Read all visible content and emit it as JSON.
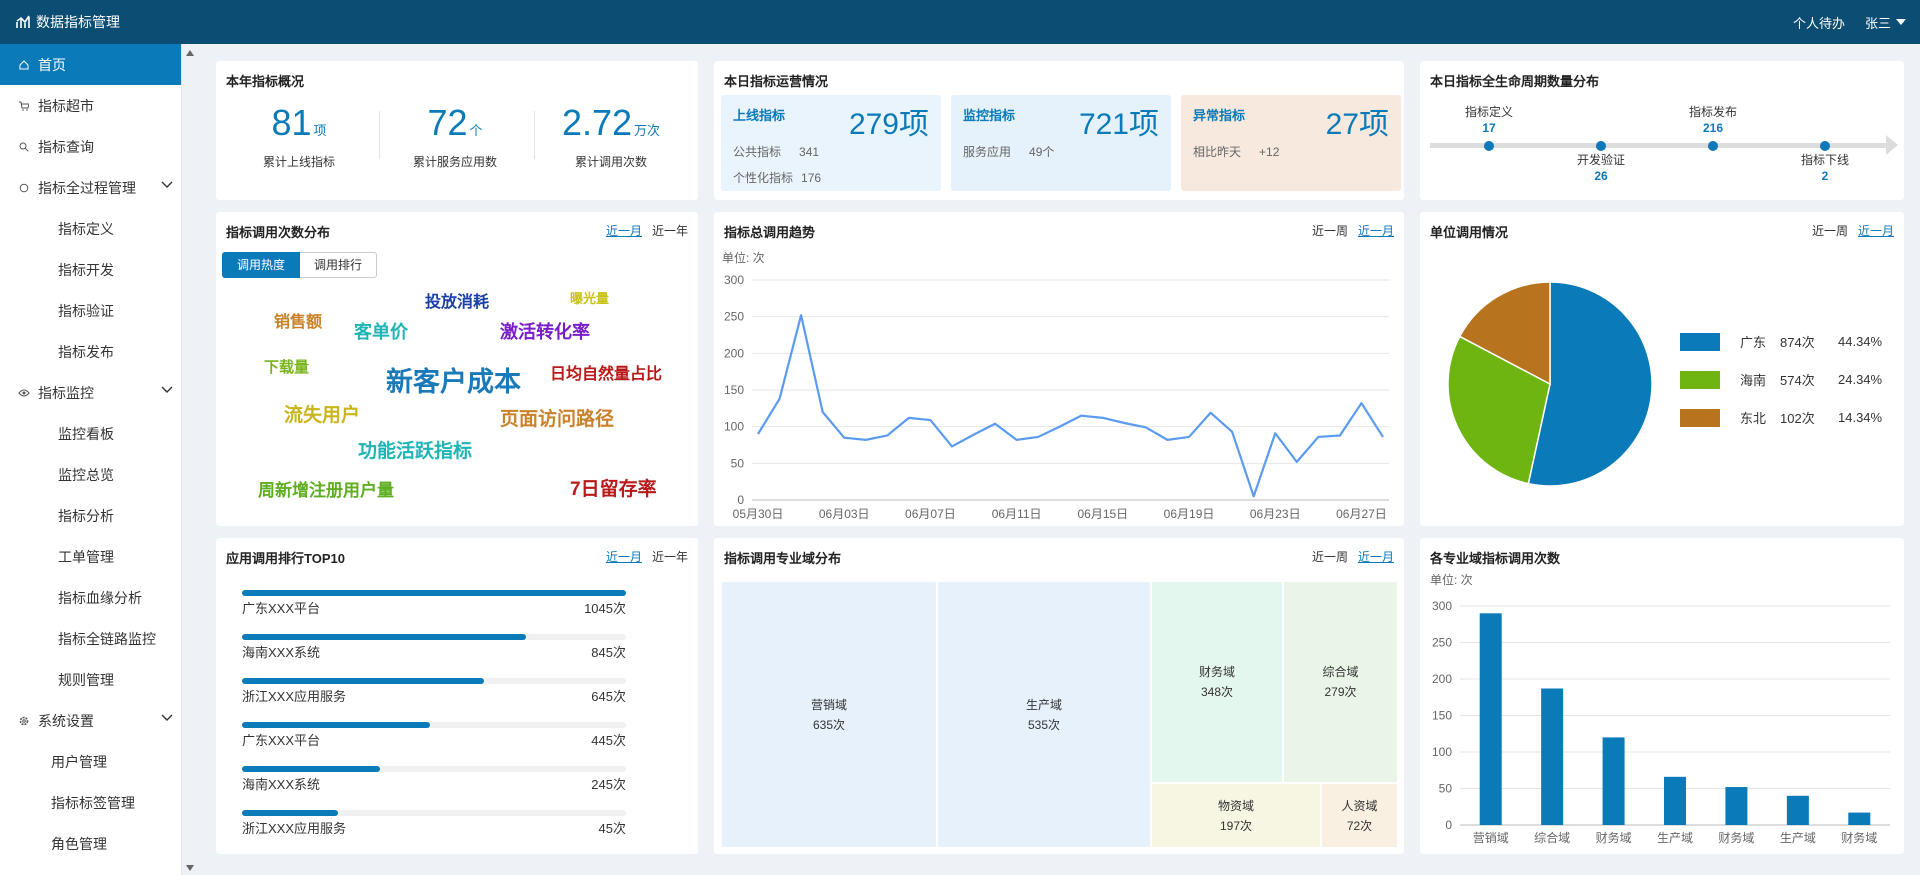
{
  "header": {
    "title": "数据指标管理",
    "todo": "个人待办",
    "user": "张三"
  },
  "sidebar": {
    "home": "首页",
    "market": "指标超市",
    "query": "指标查询",
    "lifecycle": {
      "label": "指标全过程管理",
      "items": [
        "指标定义",
        "指标开发",
        "指标验证",
        "指标发布"
      ]
    },
    "monitor": {
      "label": "指标监控",
      "items": [
        "监控看板",
        "监控总览",
        "指标分析",
        "工单管理",
        "指标血缘分析",
        "指标全链路监控",
        "规则管理"
      ]
    },
    "system": {
      "label": "系统设置",
      "items": [
        "用户管理",
        "指标标签管理",
        "角色管理"
      ]
    }
  },
  "overview": {
    "title": "本年指标概况",
    "items": [
      {
        "value": "81",
        "unit": "项",
        "label": "累计上线指标"
      },
      {
        "value": "72",
        "unit": "个",
        "label": "累计服务应用数"
      },
      {
        "value": "2.72",
        "unit": "万次",
        "label": "累计调用次数"
      }
    ]
  },
  "ops": {
    "title": "本日指标运营情况",
    "online": {
      "name": "上线指标",
      "value": "279项",
      "rows": [
        [
          "公共指标",
          "341"
        ],
        [
          "个性化指标",
          "176"
        ]
      ]
    },
    "monitor": {
      "name": "监控指标",
      "value": "721项",
      "rows": [
        [
          "服务应用",
          "49个"
        ]
      ]
    },
    "abnormal": {
      "name": "异常指标",
      "value": "27项",
      "rows": [
        [
          "相比昨天",
          "+12"
        ]
      ]
    }
  },
  "lifecycle": {
    "title": "本日指标全生命周期数量分布",
    "stages": [
      {
        "label": "指标定义",
        "value": "17"
      },
      {
        "label": "开发验证",
        "value": "26"
      },
      {
        "label": "指标发布",
        "value": "216"
      },
      {
        "label": "指标下线",
        "value": "2"
      }
    ]
  },
  "wordcloud": {
    "title": "指标调用次数分布",
    "range": [
      "近一月",
      "近一年"
    ],
    "tabs": [
      "调用热度",
      "调用排行"
    ],
    "words": [
      {
        "text": "销售额",
        "color": "#c9812a"
      },
      {
        "text": "客单价",
        "color": "#1fb5b5"
      },
      {
        "text": "投放消耗",
        "color": "#1a3fa8"
      },
      {
        "text": "曝光量",
        "color": "#c8c21a"
      },
      {
        "text": "激活转化率",
        "color": "#7a1fc7"
      },
      {
        "text": "下载量",
        "color": "#7ab51f"
      },
      {
        "text": "新客户成本",
        "color": "#1a7ab8"
      },
      {
        "text": "日均自然量占比",
        "color": "#b81a1a"
      },
      {
        "text": "流失用户",
        "color": "#c8b51a"
      },
      {
        "text": "页面访问路径",
        "color": "#c9812a"
      },
      {
        "text": "功能活跃指标",
        "color": "#1fb5b5"
      },
      {
        "text": "周新增注册用户量",
        "color": "#5fae1f"
      },
      {
        "text": "7日留存率",
        "color": "#b81a1a"
      }
    ]
  },
  "trend": {
    "title": "指标总调用趋势",
    "range": [
      "近一周",
      "近一月"
    ],
    "unit": "单位: 次"
  },
  "unit_calls": {
    "title": "单位调用情况",
    "range": [
      "近一周",
      "近一月"
    ],
    "legend": [
      {
        "name": "广东",
        "count": "874次",
        "pct": "44.34%",
        "color": "#0b7ab8"
      },
      {
        "name": "海南",
        "count": "574次",
        "pct": "24.34%",
        "color": "#6fb512"
      },
      {
        "name": "东北",
        "count": "102次",
        "pct": "14.34%",
        "color": "#b8731f"
      }
    ]
  },
  "ranking": {
    "title": "应用调用排行TOP10",
    "range": [
      "近一月",
      "近一年"
    ],
    "items": [
      {
        "name": "广东XXX平台",
        "value": "1045次",
        "fraction": 1.0
      },
      {
        "name": "海南XXX系统",
        "value": "845次",
        "fraction": 0.74
      },
      {
        "name": "浙江XXX应用服务",
        "value": "645次",
        "fraction": 0.63
      },
      {
        "name": "广东XXX平台",
        "value": "445次",
        "fraction": 0.49
      },
      {
        "name": "海南XXX系统",
        "value": "245次",
        "fraction": 0.36
      },
      {
        "name": "浙江XXX应用服务",
        "value": "45次",
        "fraction": 0.25
      }
    ]
  },
  "domain": {
    "title": "指标调用专业域分布",
    "range": [
      "近一周",
      "近一月"
    ],
    "cells": [
      {
        "name": "营销域",
        "value": "635次",
        "color": "#e6f1fc"
      },
      {
        "name": "生产域",
        "value": "535次",
        "color": "#e6f1fc"
      },
      {
        "name": "财务域",
        "value": "348次",
        "color": "#e4f7ee"
      },
      {
        "name": "综合域",
        "value": "279次",
        "color": "#e9f6e7"
      },
      {
        "name": "物资域",
        "value": "197次",
        "color": "#f6f6e2"
      },
      {
        "name": "人资域",
        "value": "72次",
        "color": "#f9f0e2"
      }
    ]
  },
  "domain_bar": {
    "title": "各专业域指标调用次数",
    "unit": "单位: 次"
  },
  "chart_data": [
    {
      "type": "line",
      "x": [
        "05月30日",
        "05月31日",
        "06月01日",
        "06月02日",
        "06月03日",
        "06月04日",
        "06月05日",
        "06月06日",
        "06月07日",
        "06月08日",
        "06月09日",
        "06月10日",
        "06月11日",
        "06月12日",
        "06月13日",
        "06月14日",
        "06月15日",
        "06月16日",
        "06月17日",
        "06月18日",
        "06月19日",
        "06月20日",
        "06月21日",
        "06月22日",
        "06月23日",
        "06月24日",
        "06月25日",
        "06月26日",
        "06月27日",
        "06月28日"
      ],
      "xticks": [
        "05月30日",
        "06月03日",
        "06月07日",
        "06月11日",
        "06月15日",
        "06月19日",
        "06月23日",
        "06月27日"
      ],
      "values": [
        90,
        138,
        252,
        120,
        85,
        82,
        88,
        112,
        109,
        73,
        89,
        104,
        82,
        86,
        100,
        115,
        112,
        105,
        99,
        82,
        86,
        119,
        93,
        5,
        91,
        52,
        86,
        88,
        132,
        86
      ],
      "ylim": [
        0,
        300
      ],
      "yticks": [
        0,
        50,
        100,
        150,
        200,
        250,
        300
      ],
      "color": "#5b9bef",
      "grid": true
    },
    {
      "type": "pie",
      "labels": [
        "广东",
        "海南",
        "东北"
      ],
      "values": [
        44.34,
        24.34,
        14.34
      ],
      "colors": [
        "#0b7ab8",
        "#6fb512",
        "#b8731f"
      ]
    },
    {
      "type": "bar",
      "categories": [
        "营销域",
        "综合域",
        "财务域",
        "生产域",
        "财务域",
        "生产域",
        "财务域"
      ],
      "values": [
        290,
        187,
        120,
        66,
        52,
        40,
        17
      ],
      "ylim": [
        0,
        300
      ],
      "yticks": [
        0,
        50,
        100,
        150,
        200,
        250,
        300
      ],
      "color": "#0b7ab8",
      "grid": true
    }
  ]
}
